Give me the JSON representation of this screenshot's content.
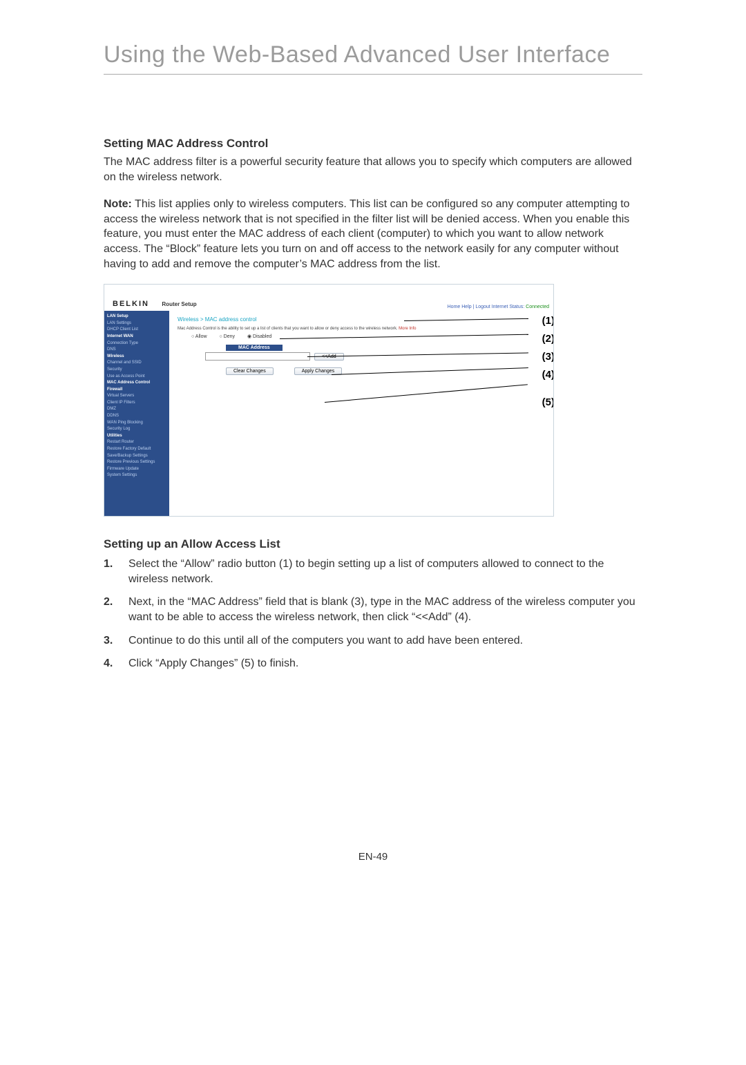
{
  "page_title": "Using the Web-Based Advanced User Interface",
  "section1": {
    "heading": "Setting MAC Address Control",
    "para1": "The MAC address filter is a powerful security feature that allows you to specify which computers are allowed on the wireless network.",
    "para2_prefix": "Note:",
    "para2": " This list applies only to wireless computers. This list can be configured so any computer attempting to access the wireless network that is not specified in the filter list will be denied access. When you enable this feature, you must enter the MAC address of each client (computer) to which you want to allow network access. The “Block” feature lets you turn on and off access to the network easily for any computer without having to add and remove the computer’s MAC address from the list."
  },
  "screenshot": {
    "brand": "BELKIN",
    "setup": "Router Setup",
    "toplinks": "Home  Help | Logout   Internet Status:",
    "status": "Connected",
    "breadcrumb": "Wireless > MAC address control",
    "desc": "Mac Address Control is the ability to set up a list of clients that you want to allow or deny access to the wireless network.",
    "more": "More Info",
    "radio_allow": "Allow",
    "radio_deny": "Deny",
    "radio_disabled": "Disabled",
    "mac_header": "MAC Address",
    "add_btn": "<<Add",
    "clear_btn": "Clear Changes",
    "apply_btn": "Apply Changes",
    "sidebar": {
      "lan_setup": "LAN Setup",
      "lan_settings": "LAN Settings",
      "dhcp": "DHCP Client List",
      "internet_wan": "Internet WAN",
      "conn_type": "Connection Type",
      "dns": "DNS",
      "wireless": "Wireless",
      "channel": "Channel and SSID",
      "security": "Security",
      "use_ap": "Use as Access Point",
      "mac_ctrl": "MAC Address Control",
      "firewall": "Firewall",
      "virtual": "Virtual Servers",
      "client_ip": "Client IP Filters",
      "dmz": "DMZ",
      "ddns": "DDNS",
      "wan_ping": "WAN Ping Blocking",
      "sec_log": "Security Log",
      "utilities": "Utilities",
      "restart": "Restart Router",
      "restore_def": "Restore Factory Default",
      "save_backup": "Save/Backup Settings",
      "restore_prev": "Restore Previous Settings",
      "firmware": "Firmware Update",
      "system": "System Settings"
    },
    "callouts": {
      "c1": "(1)",
      "c2": "(2)",
      "c3": "(3)",
      "c4": "(4)",
      "c5": "(5)"
    }
  },
  "section2": {
    "heading": "Setting up an Allow Access List",
    "steps": {
      "s1": "Select the “Allow” radio button (1) to begin setting up a list of computers allowed to connect to the wireless network.",
      "s2": "Next, in the “MAC Address” field that is blank (3), type in the MAC address of the wireless computer you want to be able to access the wireless network, then click “<<Add” (4).",
      "s3": "Continue to do this until all of the computers you want to add have been entered.",
      "s4": "Click “Apply Changes” (5) to finish."
    },
    "nums": {
      "n1": "1.",
      "n2": "2.",
      "n3": "3.",
      "n4": "4."
    }
  },
  "footer": "EN-49"
}
